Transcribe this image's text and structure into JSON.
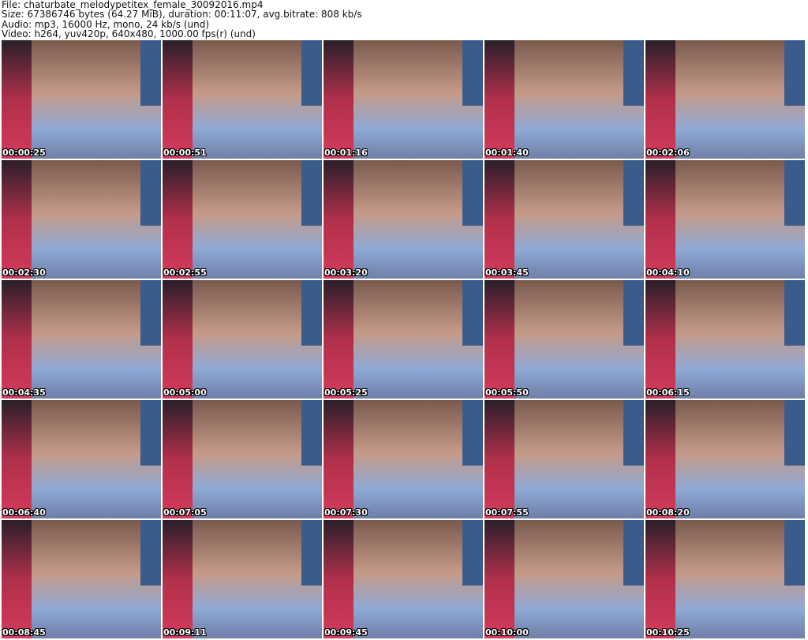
{
  "header": {
    "file": "File: chaturbate_melodypetitex_female_30092016.mp4",
    "size": "Size: 67386746 bytes (64.27 MiB), duration: 00:11:07, avg.bitrate: 808 kb/s",
    "audio": "Audio: mp3, 16000 Hz, mono, 24 kb/s (und)",
    "video": "Video: h264, yuv420p, 640x480, 1000.00 fps(r) (und)"
  },
  "thumbnails": [
    "00:00:25",
    "00:00:51",
    "00:01:16",
    "00:01:40",
    "00:02:06",
    "00:02:30",
    "00:02:55",
    "00:03:20",
    "00:03:45",
    "00:04:10",
    "00:04:35",
    "00:05:00",
    "00:05:25",
    "00:05:50",
    "00:06:15",
    "00:06:40",
    "00:07:05",
    "00:07:30",
    "00:07:55",
    "00:08:20",
    "00:08:45",
    "00:09:11",
    "00:09:45",
    "00:10:00",
    "00:10:25"
  ]
}
